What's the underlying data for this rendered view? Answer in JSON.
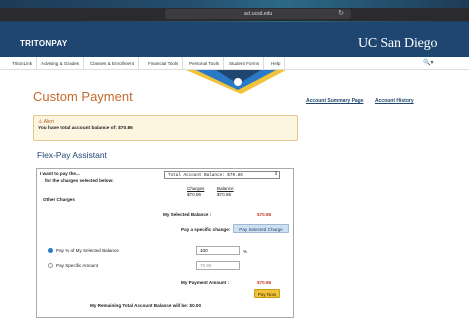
{
  "browser": {
    "url": "act.ucsd.edu",
    "reload_glyph": "↻"
  },
  "header": {
    "brand_left": "TRITONPAY",
    "brand_right": "UC San Diego"
  },
  "nav": {
    "items": [
      "TritonLink",
      "Advising & Grades",
      "Classes & Enrollment",
      "Financial Tools",
      "Personal Tools",
      "Student Forms",
      "Help"
    ],
    "search_glyph": "🔍▾"
  },
  "page": {
    "title": "Custom Payment",
    "link_summary": "Account Summary Page",
    "link_history": "Account History"
  },
  "alert": {
    "title": "⚠ Alert",
    "text": "You have total account balance of: $70.86"
  },
  "flexpay": {
    "title": "Flex-Pay Assistant",
    "pay_label": "I want to pay the...",
    "charges_label": "for the charges selected below:",
    "select_value": "Total Account Balance:           $70.86",
    "col_charges": "Charges",
    "col_balance": "Balance",
    "charges_value": "$70.86",
    "balance_value": "$70.86",
    "other_charges": "Other Charges",
    "my_selected_balance_label": "My Selected Balance :",
    "my_selected_balance_value": "$70.86",
    "pay_specific_change_label": "Pay a specific change:",
    "pay_selected_charge_button": "Pay Selected Charge",
    "radio_pct_label": "Pay % of My Selected Balance",
    "radio_amount_label": "Pay Specific Amount",
    "pct_value": "100",
    "pct_symbol": "%",
    "amount_value": "70.86",
    "my_payment_amount_label": "My Payment Amount :",
    "my_payment_amount_value": "$70.86",
    "pay_now_button": "Pay Now",
    "remaining_text": "My Remaining Total Account Balance will be: $0.00"
  }
}
